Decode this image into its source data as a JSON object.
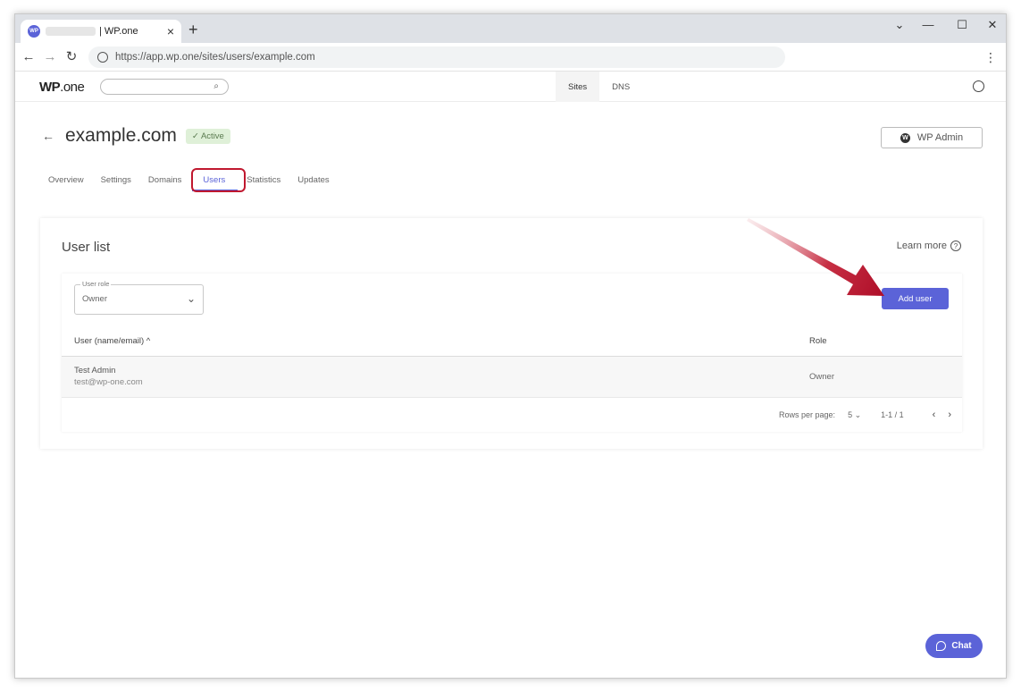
{
  "browser": {
    "tab_title": "| WP.one",
    "tab_favicon": "WP",
    "new_tab": "+",
    "url": "https://app.wp.one/sites/users/example.com",
    "icons": {
      "back": "arrow-left-icon",
      "forward": "arrow-right-icon",
      "reload": "reload-icon",
      "minimize": "minimize-icon",
      "maximize": "maximize-icon",
      "close": "close-icon"
    }
  },
  "app": {
    "logo_bold": "WP",
    "logo_light": ".one",
    "nav": [
      {
        "label": "Sites"
      },
      {
        "label": "DNS"
      }
    ]
  },
  "page": {
    "site_name": "example.com",
    "status_badge": "✓  Active",
    "wp_admin_label": "WP Admin",
    "wp_admin_logo": "W",
    "tabs": [
      {
        "label": "Overview"
      },
      {
        "label": "Settings"
      },
      {
        "label": "Domains"
      },
      {
        "label": "Users"
      },
      {
        "label": "Statistics"
      },
      {
        "label": "Updates"
      }
    ],
    "active_tab": "Users"
  },
  "user_list": {
    "title": "User list",
    "learn_more": "Learn more",
    "role_filter": {
      "label": "User role",
      "value": "Owner"
    },
    "add_user_label": "Add user",
    "columns": [
      {
        "label": "User (name/email)  ^"
      },
      {
        "label": "Role"
      }
    ],
    "rows": [
      {
        "name": "Test Admin",
        "email": "test@wp-one.com",
        "role": "Owner"
      }
    ],
    "pagination": {
      "rows_per_page_label": "Rows per page:",
      "rows_per_page_value": "5",
      "range": "1-1 / 1"
    }
  },
  "chat": {
    "label": "Chat"
  },
  "colors": {
    "accent": "#5b63d8",
    "annotation_red": "#c0182f",
    "badge_bg": "#dff0d8"
  }
}
